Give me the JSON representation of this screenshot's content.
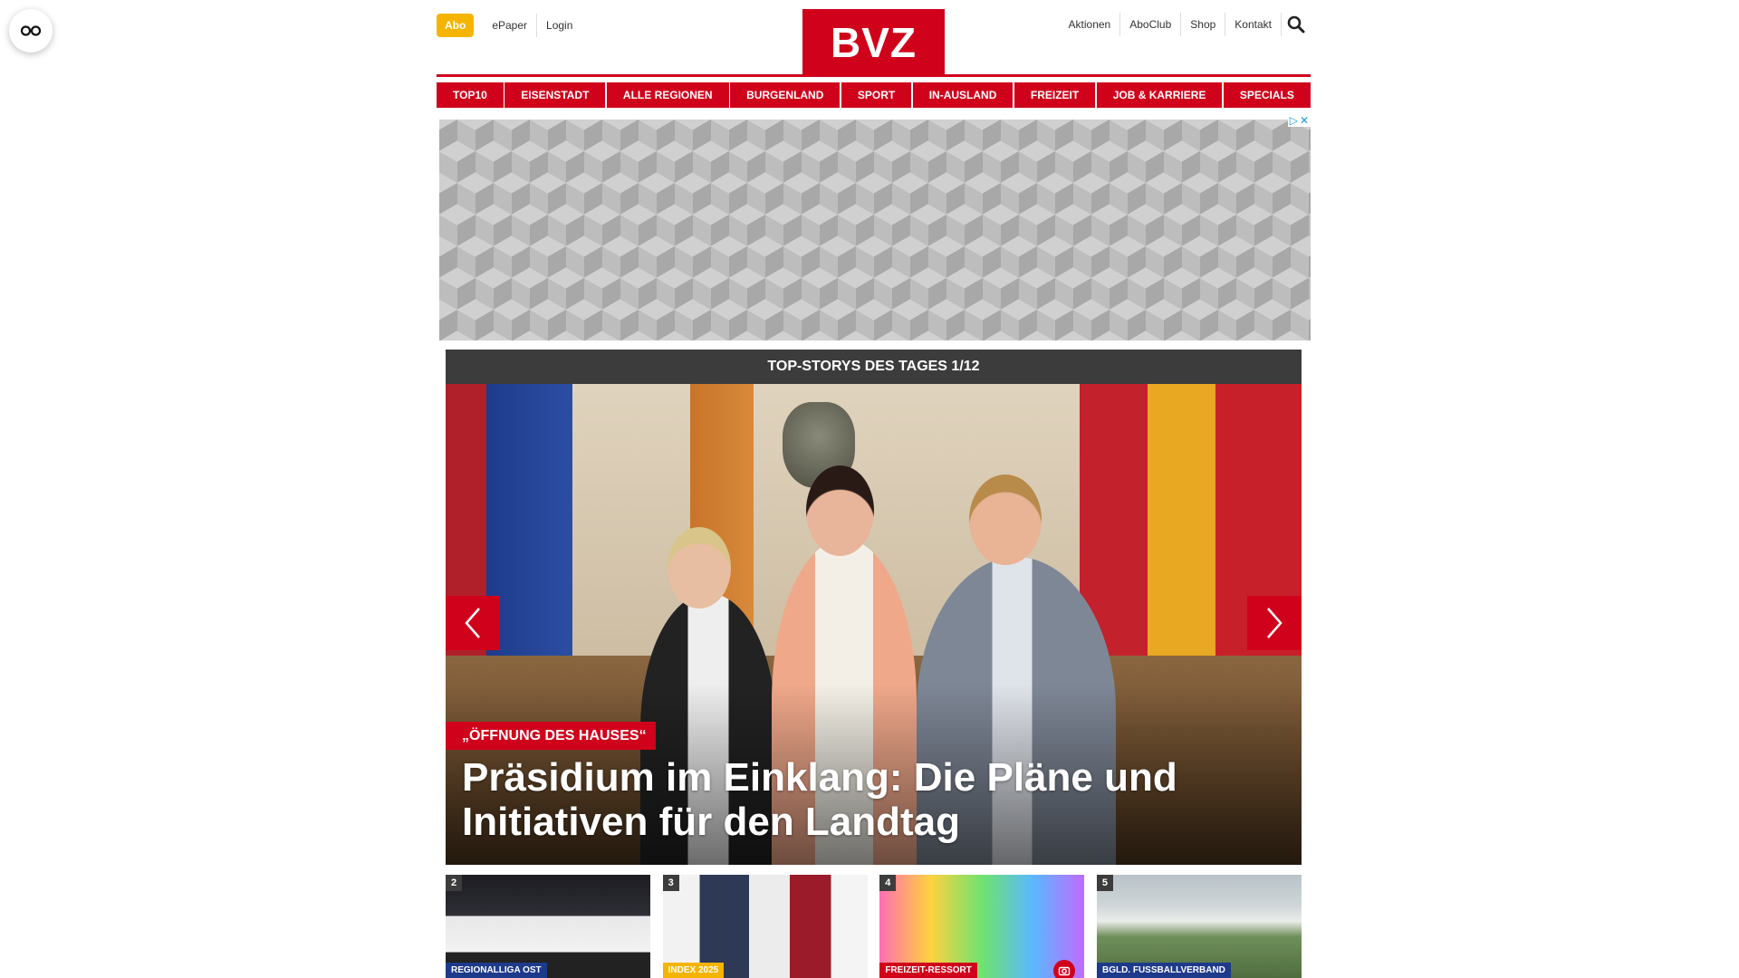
{
  "colors": {
    "brand_red": "#d0021b",
    "abo_yellow": "#f5b400",
    "dark_bar": "#3c3c3c",
    "ad_choice_blue": "#1a9bd7"
  },
  "reader": {
    "icon": "reader-glasses-icon"
  },
  "header": {
    "abo_label": "Abo",
    "left_links": [
      "ePaper",
      "Login"
    ],
    "logo_text": "BVZ",
    "right_links": [
      "Aktionen",
      "AboClub",
      "Shop",
      "Kontakt"
    ],
    "search_icon": "search-icon"
  },
  "nav": {
    "items": [
      "TOP10",
      "EISENSTADT",
      "ALLE REGIONEN",
      "BURGENLAND",
      "SPORT",
      "IN-AUSLAND",
      "FREIZEIT",
      "JOB & KARRIERE",
      "SPECIALS"
    ]
  },
  "ad": {
    "marks": [
      "▷",
      "✕"
    ]
  },
  "top_stories": {
    "heading": "TOP-STORYS DES TAGES 1/12",
    "hero": {
      "kicker": "„ÖFFNUNG DES HAUSES“",
      "title": "Präsidium im Einklang: Die Pläne und Initiativen für den Landtag"
    },
    "prev_icon": "chevron-left-icon",
    "next_icon": "chevron-right-icon"
  },
  "thumbs": [
    {
      "number": "2",
      "tag": "REGIONALLIGA OST",
      "tag_color": "#1e3a8a"
    },
    {
      "number": "3",
      "tag": "INDEX 2025",
      "tag_color": "#f5b400"
    },
    {
      "number": "4",
      "tag": "FREIZEIT-RESSORT",
      "tag_color": "#d0021b",
      "badge_icon": "camera-icon"
    },
    {
      "number": "5",
      "tag": "BGLD. FUSSBALLVERBAND",
      "tag_color": "#1e3a8a"
    }
  ]
}
